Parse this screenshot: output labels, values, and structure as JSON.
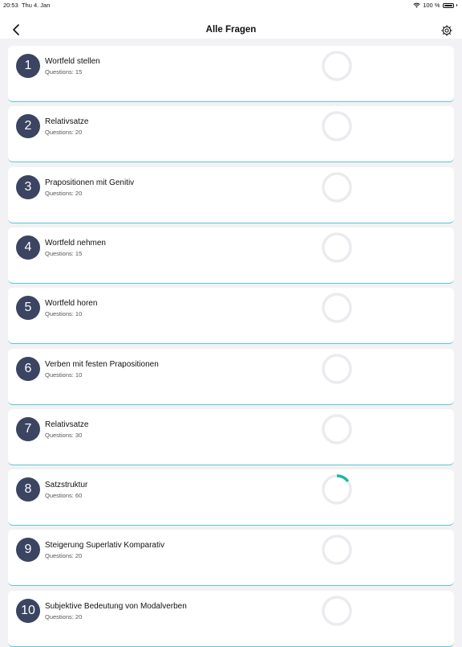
{
  "status_bar": {
    "time": "20:53",
    "date": "Thu 4. Jan",
    "battery": "100 %"
  },
  "nav": {
    "title": "Alle Fragen",
    "back_icon": "chevron-left-icon",
    "settings_icon": "gear-icon"
  },
  "colors": {
    "accent": "#1fb5a8",
    "badge": "#3b4460",
    "ring_track": "#ebebef",
    "divider": "#5ec7cf"
  },
  "items": [
    {
      "number": "1",
      "title": "Wortfeld stellen",
      "questions": "Questions: 15",
      "progress": 0
    },
    {
      "number": "2",
      "title": "Relativsatze",
      "questions": "Questions: 20",
      "progress": 0
    },
    {
      "number": "3",
      "title": "Prapositionen mit Genitiv",
      "questions": "Questions: 20",
      "progress": 0
    },
    {
      "number": "4",
      "title": "Wortfeld nehmen",
      "questions": "Questions: 15",
      "progress": 0
    },
    {
      "number": "5",
      "title": "Wortfeld horen",
      "questions": "Questions: 10",
      "progress": 0
    },
    {
      "number": "6",
      "title": "Verben mit festen Prapositionen",
      "questions": "Questions: 10",
      "progress": 0
    },
    {
      "number": "7",
      "title": "Relativsatze",
      "questions": "Questions: 30",
      "progress": 0
    },
    {
      "number": "8",
      "title": "Satzstruktur",
      "questions": "Questions: 60",
      "progress": 0.15
    },
    {
      "number": "9",
      "title": "Steigerung Superlativ Komparativ",
      "questions": "Questions: 20",
      "progress": 0
    },
    {
      "number": "10",
      "title": "Subjektive Bedeutung von Modalverben",
      "questions": "Questions: 20",
      "progress": 0
    }
  ]
}
